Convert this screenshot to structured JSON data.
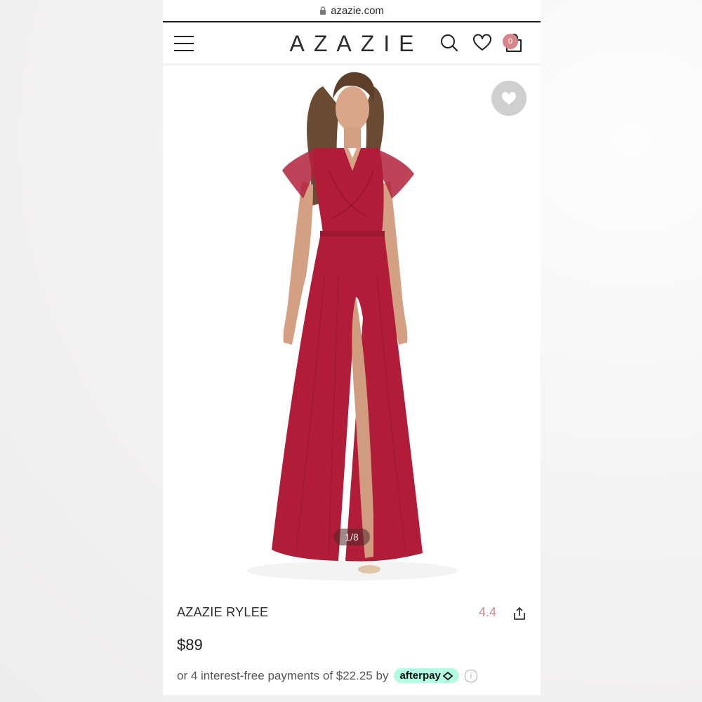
{
  "browser": {
    "url": "azazie.com"
  },
  "header": {
    "logo": "AZAZIE",
    "cart_count": "0"
  },
  "gallery": {
    "counter": "1/8",
    "dress_color": "#b11d38"
  },
  "product": {
    "name": "AZAZIE RYLEE",
    "rating": "4.4",
    "price": "$89",
    "installments_text": "or 4 interest-free payments of $22.25 by",
    "afterpay_label": "afterpay",
    "info_glyph": "i"
  },
  "colors": {
    "accent_pink": "#d7868c",
    "rating_pink": "#c98a91",
    "afterpay_mint": "#b2fce4"
  },
  "icons": [
    "lock-icon",
    "menu-icon",
    "search-icon",
    "heart-icon",
    "shopping-bag-icon",
    "favorite-heart-icon",
    "share-icon",
    "afterpay-arrows-icon",
    "info-icon"
  ]
}
